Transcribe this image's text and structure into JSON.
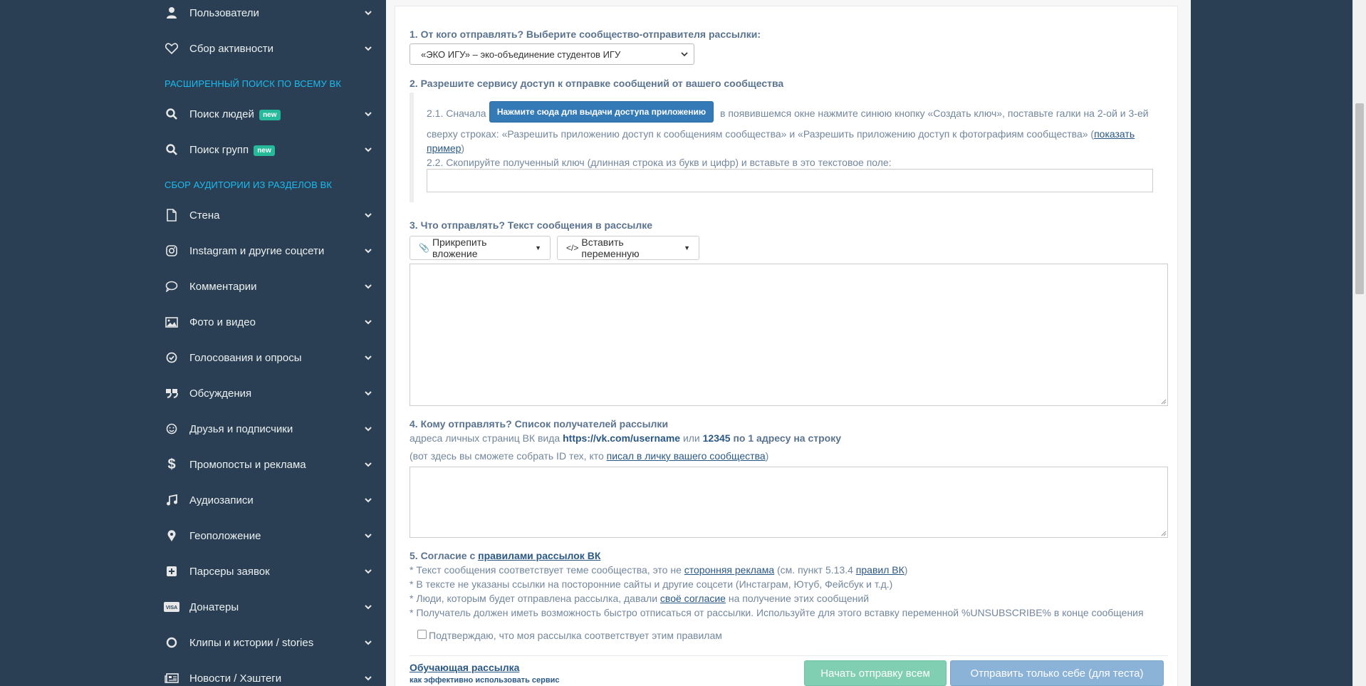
{
  "sidebar": {
    "items_top": [
      {
        "label": "Пользователи",
        "icon": "user-icon"
      },
      {
        "label": "Сбор активности",
        "icon": "heart-icon"
      }
    ],
    "section_search": "РАСШИРЕННЫЙ ПОИСК ПО ВСЕМУ ВК",
    "items_search": [
      {
        "label": "Поиск людей",
        "badge": "new",
        "icon": "search-icon"
      },
      {
        "label": "Поиск групп",
        "badge": "new",
        "icon": "search-icon"
      }
    ],
    "section_audience": "СБОР АУДИТОРИИ ИЗ РАЗДЕЛОВ ВК",
    "items_audience": [
      {
        "label": "Стена",
        "icon": "file-icon"
      },
      {
        "label": "Instagram и другие соцсети",
        "icon": "instagram-icon"
      },
      {
        "label": "Комментарии",
        "icon": "comment-icon"
      },
      {
        "label": "Фото и видео",
        "icon": "image-icon"
      },
      {
        "label": "Голосования и опросы",
        "icon": "check-circle-icon"
      },
      {
        "label": "Обсуждения",
        "icon": "quote-icon"
      },
      {
        "label": "Друзья и подписчики",
        "icon": "smile-icon"
      },
      {
        "label": "Промопосты и реклама",
        "icon": "dollar-icon"
      },
      {
        "label": "Аудиозаписи",
        "icon": "music-icon"
      },
      {
        "label": "Геоположение",
        "icon": "map-marker-icon"
      },
      {
        "label": "Парсеры заявок",
        "icon": "plus-square-icon"
      },
      {
        "label": "Донатеры",
        "icon": "visa-icon"
      },
      {
        "label": "Клипы и истории / stories",
        "icon": "circle-icon"
      },
      {
        "label": "Новости / Хэштеги",
        "icon": "newspaper-icon"
      }
    ]
  },
  "form": {
    "step1_title": "1. От кого отправлять? Выберите сообщество-отправителя рассылки:",
    "sender_selected": "«ЭКО ИГУ» – эко-объединение студентов ИГУ",
    "step2_title": "2. Разрешите сервису доступ к отправке сообщений от вашего сообщества",
    "step21_prefix": "2.1. Сначала",
    "grant_button": "Нажмите сюда для выдачи доступа приложению",
    "step21_suffix": "в появившемся окне нажмите синюю кнопку «Создать ключ», поставьте галки на 2-ой и 3-ей",
    "step21_line2": "сверху строках: «Разрешить приложению доступ к сообщениям сообщества» и «Разрешить приложению доступ к фотографиям сообщества» (",
    "show_example_a": "показать",
    "show_example_b": "пример",
    "paren_close": ")",
    "step22": "2.2. Скопируйте полученный ключ (длинная строка из букв и цифр) и вставьте в это текстовое поле:",
    "key_value": "",
    "step3_title": "3. Что отправлять? Текст сообщения в рассылке",
    "attach_button": "Прикрепить вложение",
    "variable_button": "Вставить переменную",
    "message_value": "",
    "step4_title": "4. Кому отправлять? Список получателей рассылки",
    "step4_hint_a": "адреса личных страниц ВК вида",
    "step4_hint_url": "https://vk.com/username",
    "step4_hint_or": "или",
    "step4_hint_id": "12345",
    "step4_hint_end": "по 1 адресу на строку",
    "step4_note_a": "(вот здесь вы сможете собрать ID тех, кто",
    "step4_note_link": "писал в личку вашего сообщества",
    "step4_note_b": ")",
    "recipients_value": "",
    "step5_title_a": "5. Согласие с",
    "step5_title_link": "правилами рассылок ВК",
    "rule1_a": "* Текст сообщения соответствует теме сообщества, это не",
    "rule1_link": "сторонняя реклама",
    "rule1_b": "(см. пункт 5.13.4",
    "rule1_link2": "правил ВК",
    "rule1_c": ")",
    "rule2": "* В тексте не указаны ссылки на посторонние сайты и другие соцсети (Инстаграм, Ютуб, Фейсбук и т.д.)",
    "rule3_a": "* Люди, которым будет отправлена рассылка, давали",
    "rule3_link": "своё согласие",
    "rule3_b": "на получение этих сообщений",
    "rule4": "* Получатель должен иметь возможность быстро отписаться от рассылки. Используйте для этого вставку переменной %UNSUBSCRIBE% в конце сообщения",
    "confirm_label": "Подтверждаю, что моя рассылка соответствует этим правилам",
    "tutorial_link": "Обучающая рассылка",
    "tutorial_sub": "как эффективно использовать сервис",
    "send_all_button": "Начать отправку всем",
    "send_self_button": "Отправить только себе (для теста)"
  },
  "colors": {
    "sidebar_bg": "#2a3f54",
    "accent_section": "#1abbf0",
    "primary": "#337ab7",
    "success_disabled": "#80cfb3",
    "primary_disabled": "#8bb2d7"
  }
}
